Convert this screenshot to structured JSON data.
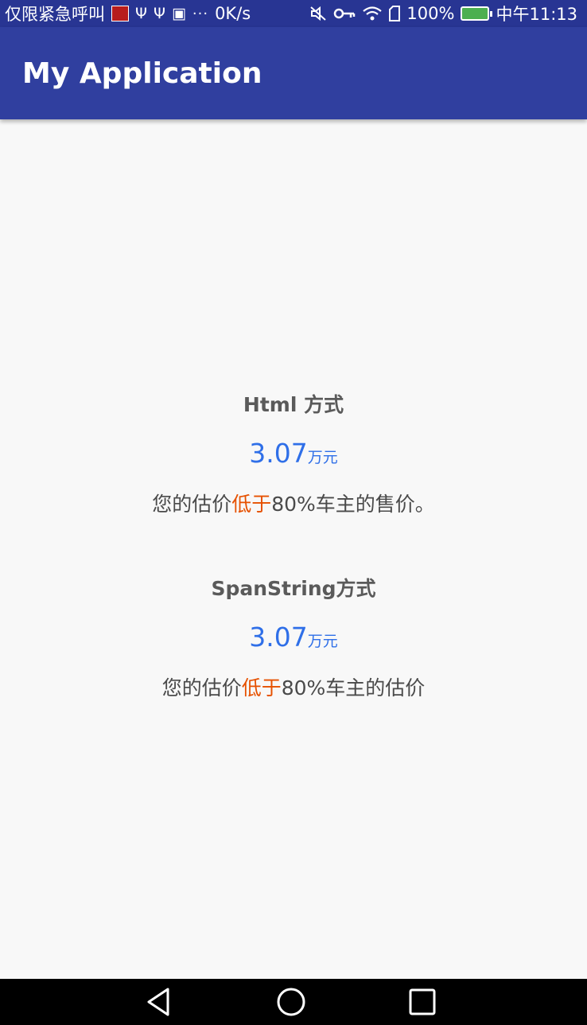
{
  "status_bar": {
    "left_text": "仅限紧急呼叫",
    "speed": "0K/s",
    "battery": "100%",
    "time": "中午11:13",
    "icons": [
      "notification-badge-icon",
      "usb-icon",
      "usb-icon",
      "app-icon",
      "more-icon",
      "mute-icon",
      "key-icon",
      "wifi-icon",
      "sim-icon",
      "battery-icon"
    ]
  },
  "app_bar": {
    "title": "My Application"
  },
  "sections": [
    {
      "title": "Html 方式",
      "price_value": "3.07",
      "price_unit": "万元",
      "desc_pre": "您的估价",
      "desc_highlight": "低于",
      "desc_post": "80%车主的售价。"
    },
    {
      "title": "SpanString方式",
      "price_value": "3.07",
      "price_unit": "万元",
      "desc_pre": "您的估价",
      "desc_highlight": "低于",
      "desc_post": "80%车主的估价"
    }
  ],
  "colors": {
    "status_bar": "#283593",
    "app_bar": "#303f9f",
    "price": "#2f6fe8",
    "highlight": "#e65100",
    "background": "#f8f8f8"
  },
  "nav_bar": {
    "icons": [
      "back-icon",
      "home-icon",
      "recents-icon"
    ]
  }
}
